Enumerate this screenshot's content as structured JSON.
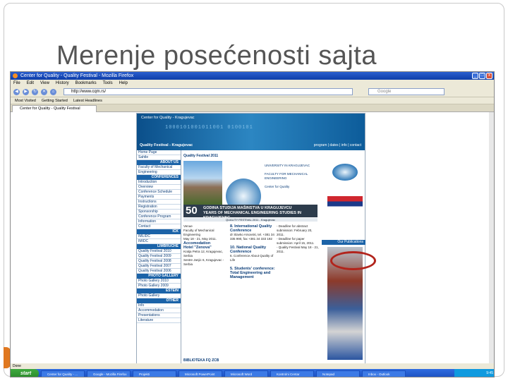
{
  "slide": {
    "title": "Merenje posećenosti sajta"
  },
  "browser": {
    "window_title": "Center for Quality - Quality Festival - Mozilla Firefox",
    "menu": [
      "File",
      "Edit",
      "View",
      "History",
      "Bookmarks",
      "Tools",
      "Help"
    ],
    "url": "http://www.cqm.rs/",
    "search_placeholder": "Google",
    "bookmarks": [
      "Most Visited",
      "Getting Started",
      "Latest Headlines"
    ],
    "tab_label": "Center for Quality - Quality Festival",
    "status": "Done"
  },
  "site": {
    "center": "Center for Quality - Kragujevac",
    "festival": "Quality Festival - Kragujevac",
    "top_links": "program | dates | info | contact",
    "banner_code": "1000101001011001 0100101",
    "nav": [
      {
        "type": "item",
        "label": "Home Page"
      },
      {
        "type": "item",
        "label": "Sahtle"
      },
      {
        "type": "head",
        "label": "ABOUT US"
      },
      {
        "type": "item",
        "label": "Faculty of Mechanical"
      },
      {
        "type": "item",
        "label": "Engineering"
      },
      {
        "type": "head",
        "label": "CONFERENCES"
      },
      {
        "type": "item",
        "label": "Introduction"
      },
      {
        "type": "item",
        "label": "Overview"
      },
      {
        "type": "item",
        "label": "Conference Schedule"
      },
      {
        "type": "item",
        "label": "Payments"
      },
      {
        "type": "item",
        "label": "Instructions"
      },
      {
        "type": "item",
        "label": "Registration"
      },
      {
        "type": "item",
        "label": "Sponsorship"
      },
      {
        "type": "item",
        "label": "Conference Program"
      },
      {
        "type": "item",
        "label": "Information"
      },
      {
        "type": "item",
        "label": "Contact"
      },
      {
        "type": "head",
        "label": "ICK"
      },
      {
        "type": "item",
        "label": "IMLIDC"
      },
      {
        "type": "item",
        "label": "IMIDC"
      },
      {
        "type": "head",
        "label": "LIMBRUCHE"
      },
      {
        "type": "item",
        "label": "Quality Festival 2010"
      },
      {
        "type": "item",
        "label": "Quality Festival 2009"
      },
      {
        "type": "item",
        "label": "Quality Festival 2008"
      },
      {
        "type": "item",
        "label": "Quality Festival 2007"
      },
      {
        "type": "item",
        "label": "Quality Festival 2006"
      },
      {
        "type": "head",
        "label": "PHOTO GALLERY"
      },
      {
        "type": "item",
        "label": "Photo Gallery 2010"
      },
      {
        "type": "item",
        "label": "Photo Gallery 2009"
      },
      {
        "type": "head",
        "label": "ESTEIN"
      },
      {
        "type": "item",
        "label": "Photo Gallery"
      },
      {
        "type": "head",
        "label": "OTHER"
      },
      {
        "type": "item",
        "label": "Info"
      },
      {
        "type": "item",
        "label": "Accommodation"
      },
      {
        "type": "item",
        "label": "Presentations"
      },
      {
        "type": "item",
        "label": "Literature"
      }
    ],
    "festival_title": "Quality Festival 2011",
    "university": "UNIVERSITY IN KRAGUJEVAC",
    "faculty": "FACULTY FOR MECHANICAL ENGINEERING",
    "center_for_quality": "Center for Quality",
    "fifty_number": "50",
    "fifty_line1": "GODINA STUDIJA MAŠINSTVA U KRAGUJEVCU",
    "fifty_line2": "YEARS OF MECHANICAL ENGINEERING STUDIES IN KRAGUJEVAC",
    "strip_text": "QUALITY FESTIVAL 2011 - Kragujevac",
    "col1": {
      "venue_label": "Venue",
      "venue": "Faculty of Mechanical Engineering",
      "dates": "May 18 - 21, May 2011.",
      "acc_label": "Accomodation",
      "hotel": "Hotel \"Zenova\"",
      "hotel_detail": "Kralja Petra 12, Kragujevac, Serbia",
      "address": "Sestre Janjic 6, Kragujevac - Serbia"
    },
    "col2": {
      "item1": "8. International Quality Conference",
      "item1_detail": "dr Slavko Arsovski, tel. +381 34 335 990, fax +381 34 333 192",
      "item2": "10. National Quality Conference",
      "item2_detail": "6. Conference About Quality of Life",
      "item3": "5. Students' conference: Total Engineering and Management"
    },
    "col3": {
      "d1": "- Deadline for abstract submission: February 20, 2011.",
      "d2": "- Deadline for paper submission: April 15, 2011.",
      "d3": "- Quality Festival May 18 - 21, 2011."
    },
    "footer_link": "BIBLIOTEKA FQ ZCB",
    "publications": "Our Publications"
  },
  "taskbar": {
    "start": "start",
    "tasks": [
      "Center for Quality - ...",
      "Google - Mozilla Firefox",
      "Projekti",
      "Microsoft PowerPoint",
      "Microsoft Word",
      "Kontrolni Centar",
      "Notepad",
      "Inbox - Outlook"
    ],
    "clock": "9:45"
  }
}
